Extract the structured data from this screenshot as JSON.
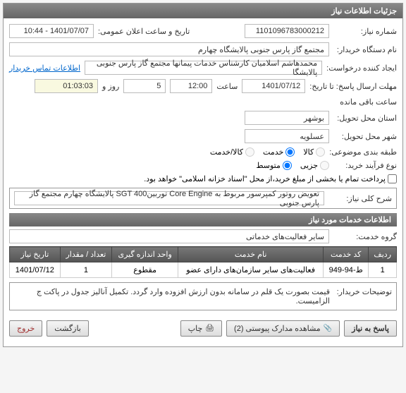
{
  "header": {
    "title": "جزئیات اطلاعات نیاز"
  },
  "info": {
    "need_no_label": "شماره نیاز:",
    "need_no": "1101096783000212",
    "announce_label": "تاریخ و ساعت اعلان عمومی:",
    "announce_value": "1401/07/07 - 10:44",
    "buyer_label": "نام دستگاه خریدار:",
    "buyer_value": "مجتمع گاز پارس جنوبی  پالایشگاه چهارم",
    "creator_label": "ایجاد کننده درخواست:",
    "creator_value": "محمدهاشم اسلامیان کارشناس خدمات پیمانها مجتمع گاز پارس جنوبی  پالایشگا",
    "contact_link": "اطلاعات تماس خریدار",
    "deadline_label": "مهلت ارسال پاسخ: تا تاریخ:",
    "deadline_date": "1401/07/12",
    "time_label": "ساعت",
    "deadline_time": "12:00",
    "days_label": "روز و",
    "days_value": "5",
    "remaining_time": "01:03:03",
    "remaining_label": "ساعت باقی مانده",
    "province_label": "استان محل تحویل:",
    "province_value": "بوشهر",
    "city_label": "شهر محل تحویل:",
    "city_value": "عسلویه",
    "category_label": "طبقه بندی موضوعی:",
    "radio_goods": "کالا",
    "radio_service": "خدمت",
    "radio_goods_service": "کالا/خدمت",
    "purchase_type_label": "نوع فرآیند خرید:",
    "radio_partial": "جزیی",
    "radio_medium": "متوسط",
    "payment_note": "پرداخت تمام یا بخشی از مبلغ خرید،از محل \"اسناد خزانه اسلامی\" خواهد بود."
  },
  "desc_panel": {
    "title": "شرح کلی نیاز:",
    "text": "تعویض روتور کمپرسور مربوط به Core Engine توربینSGT  400  پالایشگاه چهارم مجتمع گاز پارس جنوبی"
  },
  "services_panel": {
    "title": "اطلاعات خدمات مورد نیاز",
    "group_label": "گروه خدمت:",
    "group_value": "سایر فعالیت‌های خدماتی",
    "table": {
      "headers": [
        "ردیف",
        "کد خدمت",
        "نام خدمت",
        "واحد اندازه گیری",
        "تعداد / مقدار",
        "تاریخ نیاز"
      ],
      "rows": [
        {
          "idx": "1",
          "code": "ط-94-949",
          "name": "فعالیت‌های سایر سازمان‌های دارای عضو",
          "unit": "مقطوع",
          "qty": "1",
          "date": "1401/07/12"
        }
      ]
    }
  },
  "buyer_notes": {
    "label": "توضیحات خریدار:",
    "text": "قیمت بصورت یک قلم در سامانه بدون ارزش افزوده وارد گردد. تکمیل آنالیز جدول در پاکت ج الزامیست."
  },
  "buttons": {
    "respond": "پاسخ به نیاز",
    "attachments": "مشاهده مدارک پیوستی (2)",
    "print": "چاپ",
    "back": "بازگشت",
    "exit": "خروج"
  }
}
